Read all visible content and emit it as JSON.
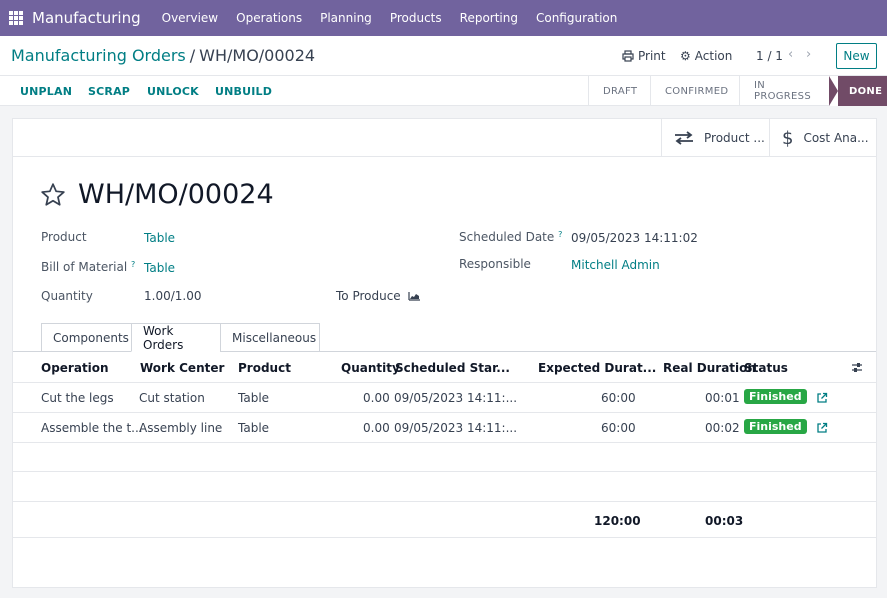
{
  "navbar": {
    "brand": "Manufacturing",
    "menu": [
      "Overview",
      "Operations",
      "Planning",
      "Products",
      "Reporting",
      "Configuration"
    ]
  },
  "breadcrumb": {
    "parent": "Manufacturing Orders",
    "separator": "/",
    "current": "WH/MO/00024"
  },
  "controls": {
    "print": "Print",
    "action": "Action",
    "pager": "1 / 1",
    "new": "New"
  },
  "statusbar": {
    "buttons": [
      "UNPLAN",
      "SCRAP",
      "UNLOCK",
      "UNBUILD"
    ],
    "stages": [
      "DRAFT",
      "CONFIRMED",
      "IN PROGRESS",
      "DONE"
    ],
    "current_stage": "DONE"
  },
  "smart_buttons": {
    "product_moves": "Product ...",
    "cost_analysis": "Cost Ana..."
  },
  "record": {
    "name": "WH/MO/00024",
    "product_label": "Product",
    "product": "Table",
    "bom_label": "Bill of Material",
    "bom": "Table",
    "quantity_label": "Quantity",
    "quantity": "1.00/1.00",
    "to_produce_label": "To Produce",
    "scheduled_date_label": "Scheduled Date",
    "scheduled_date": "09/05/2023 14:11:02",
    "responsible_label": "Responsible",
    "responsible": "Mitchell Admin",
    "tooltip_mark": "?"
  },
  "tabs": [
    "Components",
    "Work Orders",
    "Miscellaneous"
  ],
  "active_tab": "Work Orders",
  "work_orders": {
    "columns": [
      "Operation",
      "Work Center",
      "Product",
      "Quantity",
      "Scheduled Star...",
      "Expected Durat...",
      "Real Duration",
      "Status"
    ],
    "rows": [
      {
        "operation": "Cut the legs",
        "work_center": "Cut station",
        "product": "Table",
        "quantity": "0.00",
        "scheduled": "09/05/2023 14:11:...",
        "expected": "60:00",
        "real": "00:01",
        "status": "Finished"
      },
      {
        "operation": "Assemble the t...",
        "work_center": "Assembly line",
        "product": "Table",
        "quantity": "0.00",
        "scheduled": "09/05/2023 14:11:...",
        "expected": "60:00",
        "real": "00:02",
        "status": "Finished"
      }
    ],
    "totals": {
      "expected": "120:00",
      "real": "00:03"
    }
  },
  "colors": {
    "navbar": "#71639e",
    "primary": "#017e84",
    "active_stage": "#714b67",
    "finished": "#28a745"
  }
}
